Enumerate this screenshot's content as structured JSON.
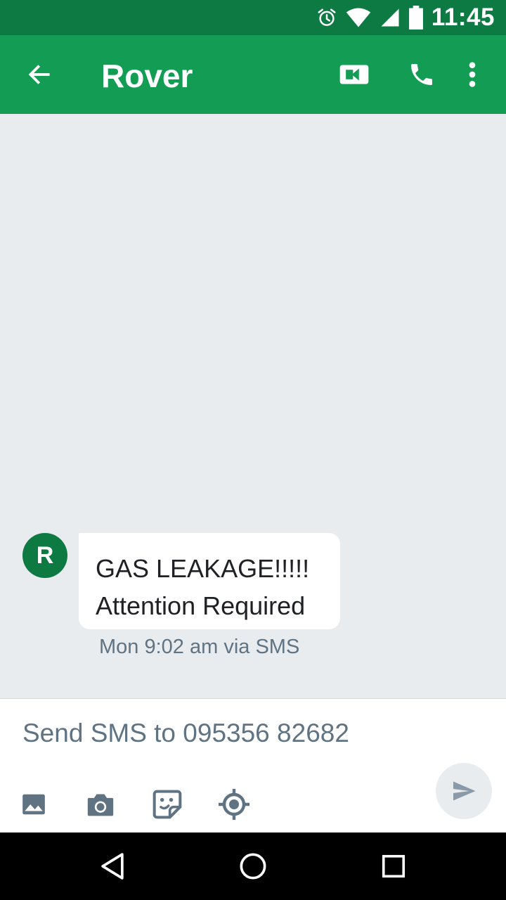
{
  "status_bar": {
    "time": "11:45",
    "icons": [
      "alarm-icon",
      "wifi-icon",
      "signal-icon",
      "battery-icon"
    ],
    "background": "#0c7a42"
  },
  "app_bar": {
    "title": "Rover",
    "icons": [
      "back-arrow-icon",
      "video-call-icon",
      "phone-icon",
      "more-vert-icon"
    ],
    "background": "#129c54"
  },
  "conversation": {
    "background": "#e9ecef",
    "messages": [
      {
        "sender_initial": "R",
        "avatar_color": "#0c7a42",
        "lines": [
          "GAS LEAKAGE!!!!!",
          "Attention Required"
        ],
        "meta": "Mon 9:02 am via SMS"
      }
    ]
  },
  "composer": {
    "placeholder": "Send SMS to 095356 82682",
    "value": "",
    "tools": [
      "image-icon",
      "camera-icon",
      "sticker-icon",
      "location-icon"
    ],
    "send_icon": "send-icon"
  },
  "nav_bar": {
    "buttons": [
      "back-triangle-icon",
      "home-circle-icon",
      "recents-square-icon"
    ]
  }
}
